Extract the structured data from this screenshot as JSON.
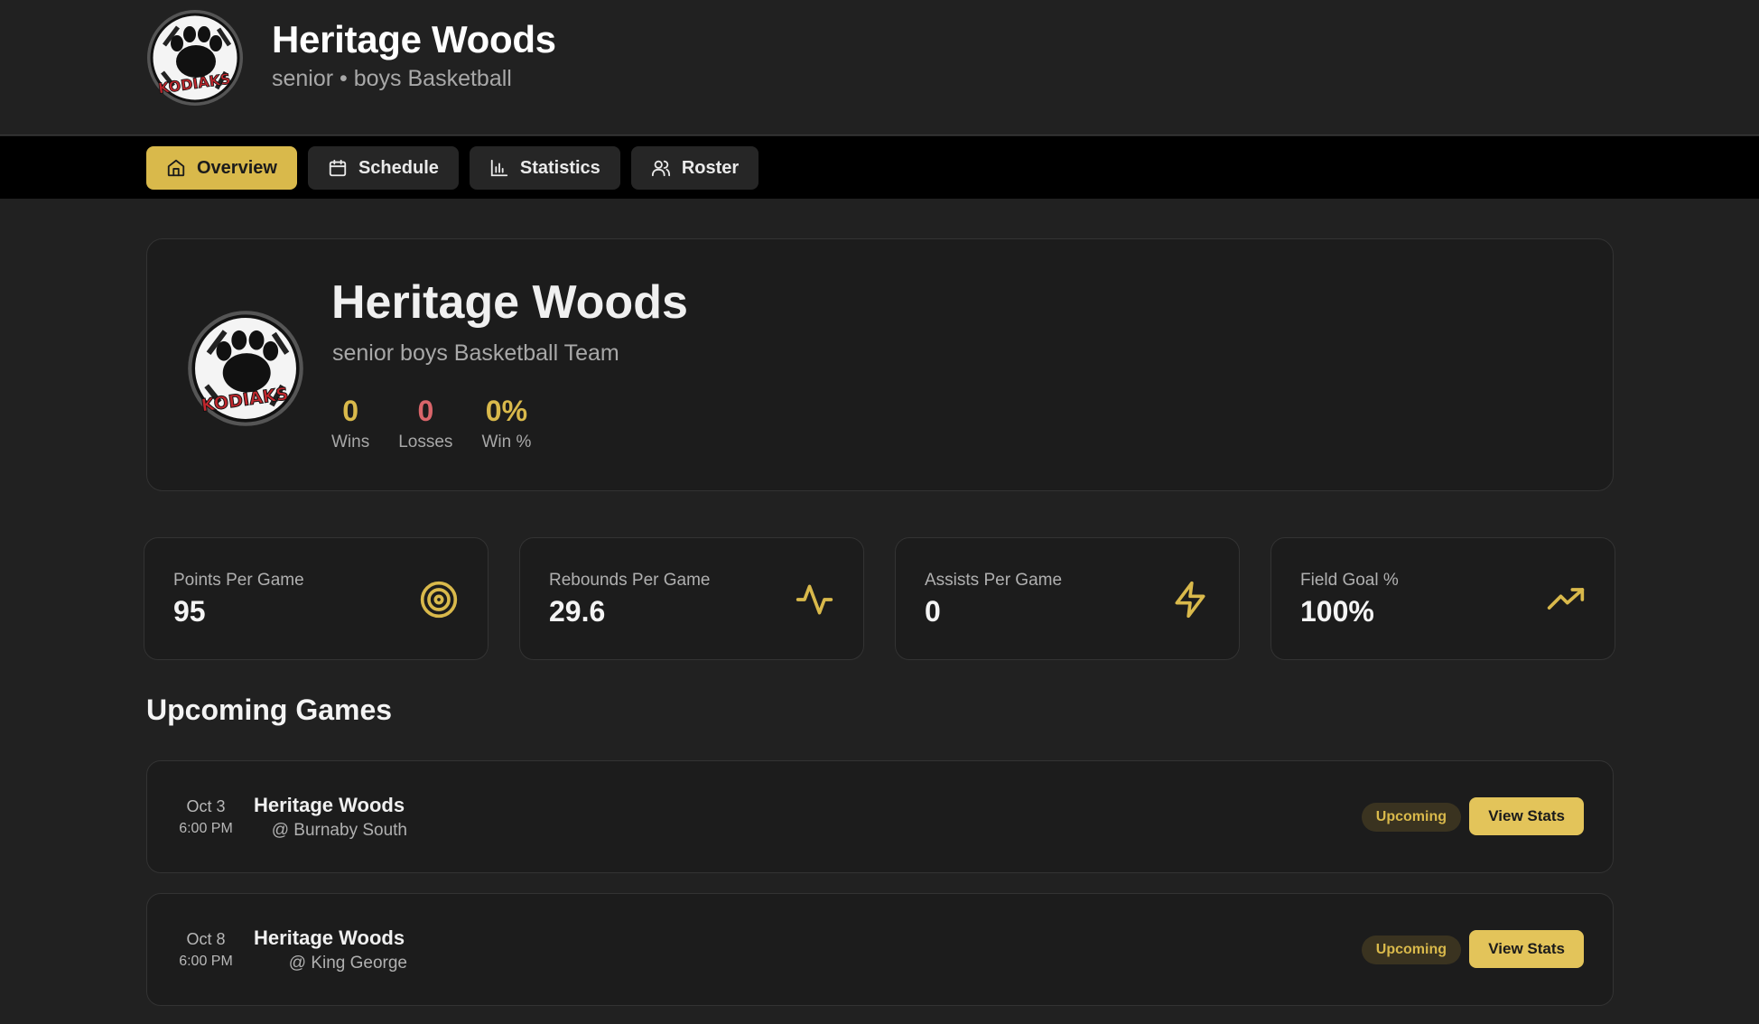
{
  "header": {
    "title": "Heritage Woods",
    "subtitle": "senior • boys Basketball",
    "logo_text": "KODIAKS"
  },
  "nav": {
    "tabs": [
      {
        "label": "Overview",
        "icon": "home-icon",
        "active": true
      },
      {
        "label": "Schedule",
        "icon": "calendar-icon",
        "active": false
      },
      {
        "label": "Statistics",
        "icon": "bar-chart-icon",
        "active": false
      },
      {
        "label": "Roster",
        "icon": "users-icon",
        "active": false
      }
    ]
  },
  "team": {
    "name": "Heritage Woods",
    "description": "senior boys Basketball Team",
    "wins": "0",
    "wins_label": "Wins",
    "losses": "0",
    "losses_label": "Losses",
    "win_pct": "0%",
    "win_pct_label": "Win %"
  },
  "stats": [
    {
      "label": "Points Per Game",
      "value": "95",
      "icon": "target-icon"
    },
    {
      "label": "Rebounds Per Game",
      "value": "29.6",
      "icon": "activity-icon"
    },
    {
      "label": "Assists Per Game",
      "value": "0",
      "icon": "lightning-icon"
    },
    {
      "label": "Field Goal %",
      "value": "100%",
      "icon": "trending-up-icon"
    }
  ],
  "upcoming": {
    "title": "Upcoming Games",
    "games": [
      {
        "date": "Oct 3",
        "time": "6:00 PM",
        "team": "Heritage Woods",
        "opponent": "@ Burnaby South",
        "status": "Upcoming",
        "action": "View Stats"
      },
      {
        "date": "Oct 8",
        "time": "6:00 PM",
        "team": "Heritage Woods",
        "opponent": "@ King George",
        "status": "Upcoming",
        "action": "View Stats"
      }
    ]
  },
  "colors": {
    "accent": "#d9b94b",
    "loss": "#d9656a",
    "background": "#212121",
    "card": "#1c1c1c"
  }
}
